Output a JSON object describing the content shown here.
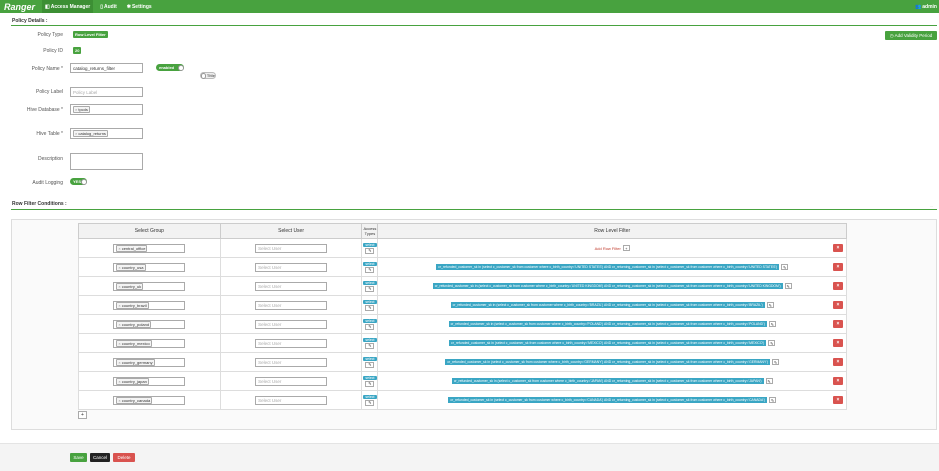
{
  "nav": {
    "brand": "Ranger",
    "items": [
      {
        "label": "Access Manager",
        "icon": "shield-icon",
        "glyph": "◧"
      },
      {
        "label": "Audit",
        "icon": "file-icon",
        "glyph": "▯"
      },
      {
        "label": "Settings",
        "icon": "gear-icon",
        "glyph": "✱"
      }
    ],
    "user": "admin",
    "user_icon": "users-icon"
  },
  "policy_details": {
    "title": "Policy Details :",
    "add_validity_label": "Add Validity Period",
    "fields": {
      "policy_type_label": "Policy Type",
      "policy_type_value": "Row Level Filter",
      "policy_id_label": "Policy ID",
      "policy_id_value": "20",
      "policy_name_label": "Policy Name *",
      "policy_name_value": "catalog_returns_filter",
      "enabled_label": "enabled",
      "override_label": "Title",
      "policy_label_label": "Policy Label",
      "policy_label_placeholder": "Policy Label",
      "hive_db_label": "Hive Database *",
      "hive_db_value": "tpcds",
      "hive_table_label": "Hive Table *",
      "hive_table_value": "catalog_returns",
      "description_label": "Description",
      "audit_logging_label": "Audit Logging",
      "audit_logging_value": "YES"
    }
  },
  "row_filter": {
    "title": "Row Filter Conditions :",
    "hint": "...",
    "headers": {
      "group": "Select Group",
      "user": "Select User",
      "access": "Access Types",
      "filter": "Row Level Filter"
    },
    "user_placeholder": "Select User",
    "access_label": "select",
    "add_filter_label": "Add Row Filter",
    "rows": [
      {
        "group": "central_office",
        "filter": ""
      },
      {
        "group": "country_usa",
        "filter": "cr_refunded_customer_sk in (select c_customer_sk from customer where c_birth_country='UNITED STATES') AND cr_returning_customer_sk in (select c_customer_sk from customer where c_birth_country='UNITED STATES')"
      },
      {
        "group": "country_uk",
        "filter": "cr_refunded_customer_sk in (select c_customer_sk from customer where c_birth_country='UNITED KINGDOM') AND cr_returning_customer_sk in (select c_customer_sk from customer where c_birth_country='UNITED KINGDOM')"
      },
      {
        "group": "country_brazil",
        "filter": "cr_refunded_customer_sk in (select c_customer_sk from customer where c_birth_country='BRAZIL') AND cr_returning_customer_sk in (select c_customer_sk from customer where c_birth_country='BRAZIL')"
      },
      {
        "group": "country_poland",
        "filter": "cr_refunded_customer_sk in (select c_customer_sk from customer where c_birth_country='POLAND') AND cr_returning_customer_sk in (select c_customer_sk from customer where c_birth_country='POLAND')"
      },
      {
        "group": "country_mexico",
        "filter": "cr_refunded_customer_sk in (select c_customer_sk from customer where c_birth_country='MEXICO') AND cr_returning_customer_sk in (select c_customer_sk from customer where c_birth_country='MEXICO')"
      },
      {
        "group": "country_germany",
        "filter": "cr_refunded_customer_sk in (select c_customer_sk from customer where c_birth_country='GERMANY') AND cr_returning_customer_sk in (select c_customer_sk from customer where c_birth_country='GERMANY')"
      },
      {
        "group": "country_japan",
        "filter": "cr_refunded_customer_sk in (select c_customer_sk from customer where c_birth_country='JAPAN') AND cr_returning_customer_sk in (select c_customer_sk from customer where c_birth_country='JAPAN')"
      },
      {
        "group": "country_canada",
        "filter": "cr_refunded_customer_sk in (select c_customer_sk from customer where c_birth_country='CANADA') AND cr_returning_customer_sk in (select c_customer_sk from customer where c_birth_country='CANADA')"
      }
    ]
  },
  "footer": {
    "save": "Save",
    "cancel": "Cancel",
    "delete": "Delete"
  },
  "colors": {
    "brand_green": "#48a23f",
    "select_blue": "#3aa6c4",
    "danger_red": "#d9534f"
  }
}
